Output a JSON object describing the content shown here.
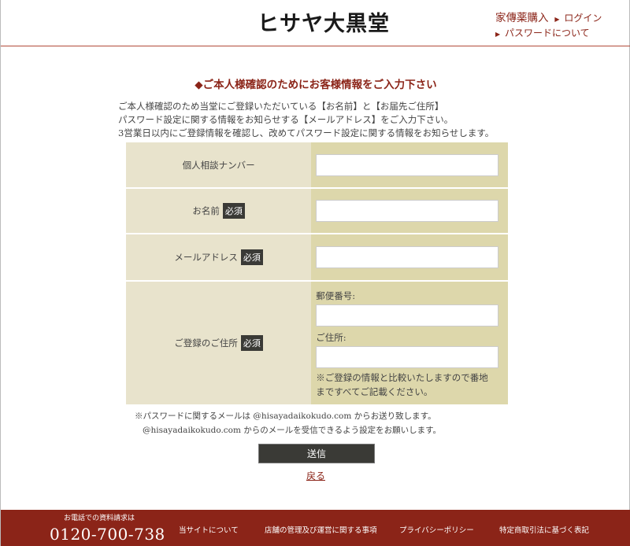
{
  "header": {
    "logo": "ヒサヤ大黒堂",
    "nav_buy": "家傳薬購入",
    "nav_login": "ログイン",
    "nav_password": "パスワードについて",
    "triangle": "▶"
  },
  "page": {
    "title": "◆ご本人様確認のためにお客様情報をご入力下さい",
    "intro": [
      "ご本人様確認のため当堂にご登録いただいている【お名前】と【お届先ご住所】",
      "パスワード設定に関する情報をお知らせする【メールアドレス】をご入力下さい。",
      "3営業日以内にご登録情報を確認し、改めてパスワード設定に関する情報をお知らせします。"
    ]
  },
  "form": {
    "required_badge": "必須",
    "consult_number_label": "個人相談ナンバー",
    "name_label": "お名前",
    "email_label": "メールアドレス",
    "address_label": "ご登録のご住所",
    "postal_label": "郵便番号:",
    "address_sub_label": "ご住所:",
    "address_note_1": "※ご登録の情報と比較いたしますので番地",
    "address_note_2": "まですべてご記載ください。",
    "consult_number_value": "",
    "name_value": "",
    "email_value": "",
    "postal_value": "",
    "address_value": ""
  },
  "notes": {
    "line1": "※パスワードに関するメールは @hisayadaikokudo.com からお送り致します。",
    "line2": "@hisayadaikokudo.com からのメールを受信できるよう設定をお願いします。"
  },
  "actions": {
    "submit": "送信",
    "back": "戻る"
  },
  "footer": {
    "tel_caption": "お電話での資料請求は",
    "tel": "0120-700-738",
    "links": [
      "当サイトについて",
      "店舗の管理及び運営に関する事項",
      "プライバシーポリシー",
      "特定商取引法に基づく表記"
    ]
  },
  "colors": {
    "accent": "#8b2418",
    "label_bg": "#e8e3cc",
    "input_bg": "#ddd7ab",
    "badge_bg": "#3a3a36"
  }
}
